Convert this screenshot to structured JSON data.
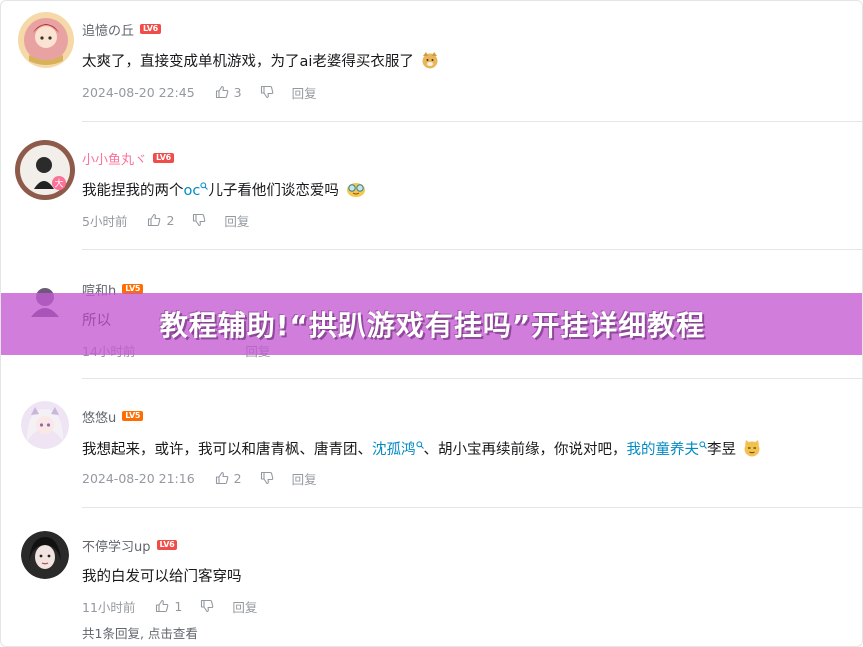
{
  "banner": {
    "title": "教程辅助!“拱趴游戏有挂吗”开挂详细教程"
  },
  "comments": [
    {
      "username": "追憶の丘",
      "level": "LV6",
      "text": "太爽了，直接变成单机游戏，为了ai老婆得买衣服了",
      "time": "2024-08-20 22:45",
      "likes": "3",
      "reply_label": "回复"
    },
    {
      "username": "小小鱼丸ヾ",
      "level": "LV6",
      "text_before": "我能捏我的两个",
      "text_link": "oc",
      "text_after": "儿子看他们谈恋爱吗",
      "time": "5小时前",
      "likes": "2",
      "reply_label": "回复"
    },
    {
      "username": "喧和h",
      "level": "LV5",
      "text": "所以",
      "time": "14小时前",
      "reply_label": "回复"
    },
    {
      "username": "悠悠u",
      "level": "LV5",
      "text_p1": "我想起来，或许，我可以和唐青枫、唐青团、",
      "text_link1": "沈孤鸿",
      "text_p2": "、胡小宝再续前缘，你说对吧，",
      "text_link2": "我的童养夫",
      "text_p3": "李昱",
      "time": "2024-08-20 21:16",
      "likes": "2",
      "reply_label": "回复"
    },
    {
      "username": "不停学习up",
      "level": "LV6",
      "text": "我的白发可以给门客穿吗",
      "time": "11小时前",
      "likes": "1",
      "reply_label": "回复",
      "sub_reply_summary": "共1条回复, 点击查看"
    }
  ],
  "colors": {
    "banner": "#c358d2",
    "link": "#008ac5",
    "level6": "#f04c49",
    "level5": "#ff6c00"
  }
}
